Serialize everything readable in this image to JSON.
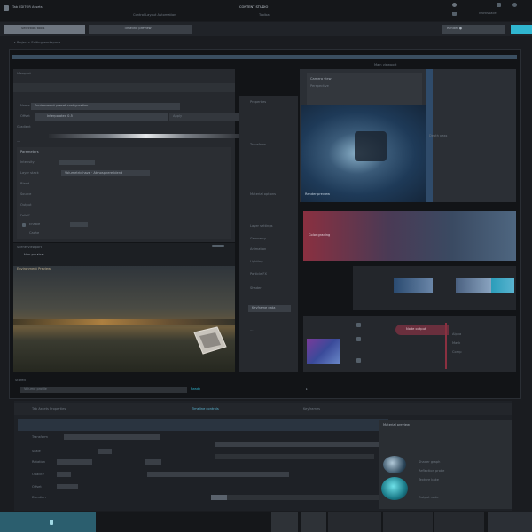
{
  "app": {
    "title": "CONTENT STUDIO",
    "left_menu_label": "Tab   EDITOR   Assets",
    "nav_items": [
      "Control   Layout   Automation",
      "Toolbar"
    ],
    "right_header": "Workspace"
  },
  "toolbar": {
    "left_button": "Selection tools",
    "mid_button": "Timeline preview",
    "right_button": "Render  ●",
    "breadcrumb": "▸ Project  ▸  Editing workspace"
  },
  "left_panel": {
    "section_label": "Viewport",
    "field_label": "Name",
    "field_value": "Environment preset configuration",
    "row2_label": "Offset",
    "row2_value": "Interpolated 0.5",
    "row2_button": "Apply",
    "row3_label": "Gradient",
    "sub_section": "Parameters",
    "params": [
      "Intensity",
      "Layer stack",
      "Blend",
      "Source",
      "Output",
      "Falloff"
    ],
    "param_value": "Volumetric haze · Atmosphere blend",
    "toggles": [
      "Enable",
      "Cache"
    ],
    "footer_label": "Scene   Viewport",
    "footer_value": "Live preview",
    "scene_label": "Environment  Preview"
  },
  "mid_panel": {
    "items": [
      "Properties",
      "Transform",
      "Material options",
      "Layer settings",
      "Geometry",
      "Animation",
      "Lighting",
      "Particle FX",
      "Shader"
    ],
    "highlight_item": "Keyframe data"
  },
  "preview": {
    "header": "Main viewport",
    "info_lines": [
      "Camera view",
      "Perspective"
    ],
    "caption": "Render preview",
    "side_label": "Depth pass",
    "swatch_label": "Color grading",
    "node_label": "Node output",
    "node_values": [
      "Alpha",
      "Mask",
      "Comp"
    ]
  },
  "bottom": {
    "tab_left": "Tab   Assets   Properties",
    "tab_mid": "Timeline controls",
    "tab_right": "Keyframes",
    "status_left": "Stored",
    "status_mid": "Ready",
    "left_field": "Volume profile",
    "rows": [
      "Transform",
      "Scale",
      "Rotation",
      "Opacity",
      "Offset",
      "Duration"
    ],
    "thumb_title": "Material preview",
    "thumb_lines": [
      "Shader graph",
      "Reflection probe",
      "Texture bake",
      "Output node"
    ]
  },
  "colors": {
    "accent": "#30b6d0",
    "panel": "#26292e",
    "highlight_red": "#8a3040"
  }
}
